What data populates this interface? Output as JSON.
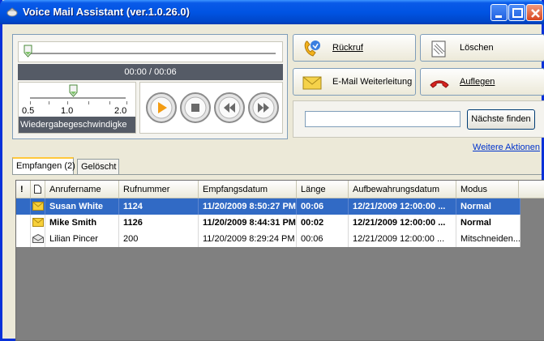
{
  "window": {
    "title": "Voice Mail Assistant (ver.1.0.26.0)"
  },
  "player": {
    "time_display": "00:00 / 00:06",
    "speed_caption": "Wiedergabegeschwindigke",
    "speed_labels": [
      "0.5",
      "1.0",
      "2.0"
    ]
  },
  "actions": {
    "callback_label": "Rückruf",
    "delete_label": "Löschen",
    "email_forward_label": "E-Mail Weiterleitung",
    "hangup_label": "Auflegen",
    "find_next_label": "Nächste finden",
    "more_actions_link": "Weitere Aktionen",
    "search_value": ""
  },
  "tabs": [
    {
      "label": "Empfangen (2)",
      "active": true
    },
    {
      "label": "Gelöscht",
      "active": false
    }
  ],
  "table": {
    "columns": [
      "!",
      "",
      "Anrufername",
      "Rufnummer",
      "Empfangsdatum",
      "Länge",
      "Aufbewahrungsdatum",
      "Modus"
    ],
    "rows": [
      {
        "name": "Susan White",
        "number": "1124",
        "received": "11/20/2009 8:50:27 PM",
        "length": "00:06",
        "retention": "12/21/2009 12:00:00 ...",
        "mode": "Normal",
        "unread": true,
        "selected": true
      },
      {
        "name": "Mike Smith",
        "number": "1126",
        "received": "11/20/2009 8:44:31 PM",
        "length": "00:02",
        "retention": "12/21/2009 12:00:00 ...",
        "mode": "Normal",
        "unread": true,
        "selected": false
      },
      {
        "name": "Lilian Pincer",
        "number": "200",
        "received": "11/20/2009 8:29:24 PM",
        "length": "00:06",
        "retention": "12/21/2009 12:00:00 ...",
        "mode": "Mitschneiden...",
        "unread": false,
        "selected": false
      }
    ]
  },
  "icons": {
    "title": "voicemail-app-icon",
    "callback": "phone-callback-icon",
    "delete": "trash-icon",
    "email": "envelope-icon",
    "hangup": "hang-up-icon",
    "play": "play-icon",
    "stop": "stop-icon",
    "rewind": "rewind-icon",
    "forward": "fast-forward-icon"
  },
  "colors": {
    "titlebar": "#0054e3",
    "selection": "#316ac5",
    "link": "#0033cc",
    "play_accent": "#f39c12"
  }
}
